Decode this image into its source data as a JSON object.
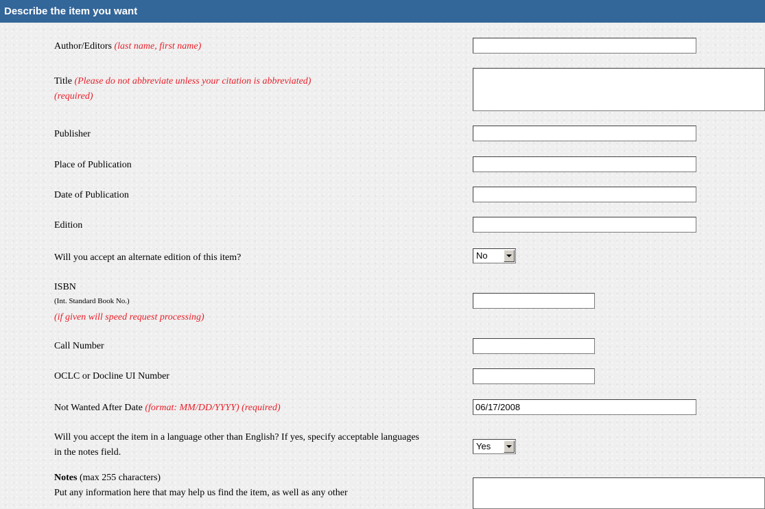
{
  "section_title": "Describe the item you want",
  "fields": {
    "author": {
      "label": "Author/Editors",
      "hint": "(last name, first name)",
      "value": ""
    },
    "title": {
      "label": "Title",
      "hint": "(Please do not abbreviate unless your citation is abbreviated)",
      "required": "(required)",
      "value": ""
    },
    "publisher": {
      "label": "Publisher",
      "value": ""
    },
    "place": {
      "label": "Place of Publication",
      "value": ""
    },
    "date": {
      "label": "Date of Publication",
      "value": ""
    },
    "edition": {
      "label": "Edition",
      "value": ""
    },
    "alt_edition": {
      "label": "Will you accept an alternate edition of this item?",
      "value": "No"
    },
    "isbn": {
      "label": "ISBN",
      "sub": "(Int. Standard Book No.)",
      "hint": "(if given will speed request processing)",
      "value": ""
    },
    "call_number": {
      "label": "Call Number",
      "value": ""
    },
    "oclc": {
      "label": "OCLC or Docline UI Number",
      "value": ""
    },
    "not_wanted": {
      "label": "Not Wanted After Date",
      "hint": "(format: MM/DD/YYYY) (required)",
      "value": "06/17/2008"
    },
    "language": {
      "label": "Will you accept the item in a language other than English? If yes, specify acceptable languages in the notes field.",
      "value": "Yes"
    },
    "notes": {
      "label_bold": "Notes",
      "label_rest": "(max 255 characters)",
      "desc": "Put any information here that may help us find the item, as well as any other",
      "value": ""
    }
  }
}
